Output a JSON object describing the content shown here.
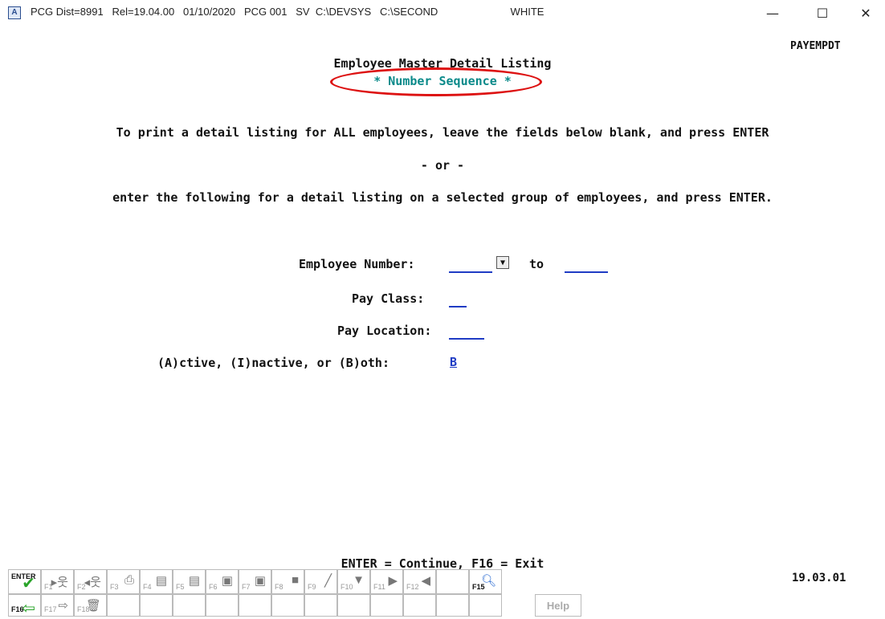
{
  "window": {
    "title": "PCG Dist=8991   Rel=19.04.00   01/10/2020   PCG 001   SV  C:\\DEVSYS   C:\\SECOND                         WHITE",
    "minimize": "—",
    "maximize": "☐",
    "close": "✕"
  },
  "screen_id": "PAYEMPDT",
  "heading": {
    "title": "Employee Master Detail Listing",
    "subtitle": "* Number Sequence *"
  },
  "instructions": {
    "line1": "To print a detail listing for ALL employees, leave the fields below blank, and press ENTER",
    "or": "- or -",
    "line2": "enter the following for a detail listing on a selected group of employees, and press ENTER."
  },
  "form": {
    "employee_number_label": "Employee Number:",
    "to_label": "to",
    "pay_class_label": "Pay Class:",
    "pay_location_label": "Pay Location:",
    "status_label": "(A)ctive, (I)nactive, or (B)oth:",
    "status_value": "B"
  },
  "footer": {
    "hint": "ENTER = Continue,  F16 = Exit",
    "version": "19.03.01"
  },
  "function_keys": {
    "row1": [
      {
        "label": "ENTER",
        "icon": "check-icon"
      },
      {
        "label": "F1",
        "icon": "person-forward-icon"
      },
      {
        "label": "F2",
        "icon": "person-back-icon"
      },
      {
        "label": "F3",
        "icon": "printer-icon"
      },
      {
        "label": "F4",
        "icon": "page-up-icon"
      },
      {
        "label": "F5",
        "icon": "page-down-icon"
      },
      {
        "label": "F6",
        "icon": "first-page-icon"
      },
      {
        "label": "F7",
        "icon": "last-page-icon"
      },
      {
        "label": "F8",
        "icon": "save-icon"
      },
      {
        "label": "F9",
        "icon": "edit-icon"
      },
      {
        "label": "F10",
        "icon": "filter-icon"
      },
      {
        "label": "F11",
        "icon": "next-icon"
      },
      {
        "label": "F12",
        "icon": "previous-icon"
      },
      {
        "label": "",
        "icon": ""
      },
      {
        "label": "F15",
        "icon": "search-icon"
      }
    ],
    "row2": [
      {
        "label": "F16",
        "icon": "exit-arrow-icon"
      },
      {
        "label": "F17",
        "icon": "export-icon"
      },
      {
        "label": "F18",
        "icon": "trash-icon"
      },
      {
        "label": "Help",
        "icon": ""
      }
    ]
  }
}
